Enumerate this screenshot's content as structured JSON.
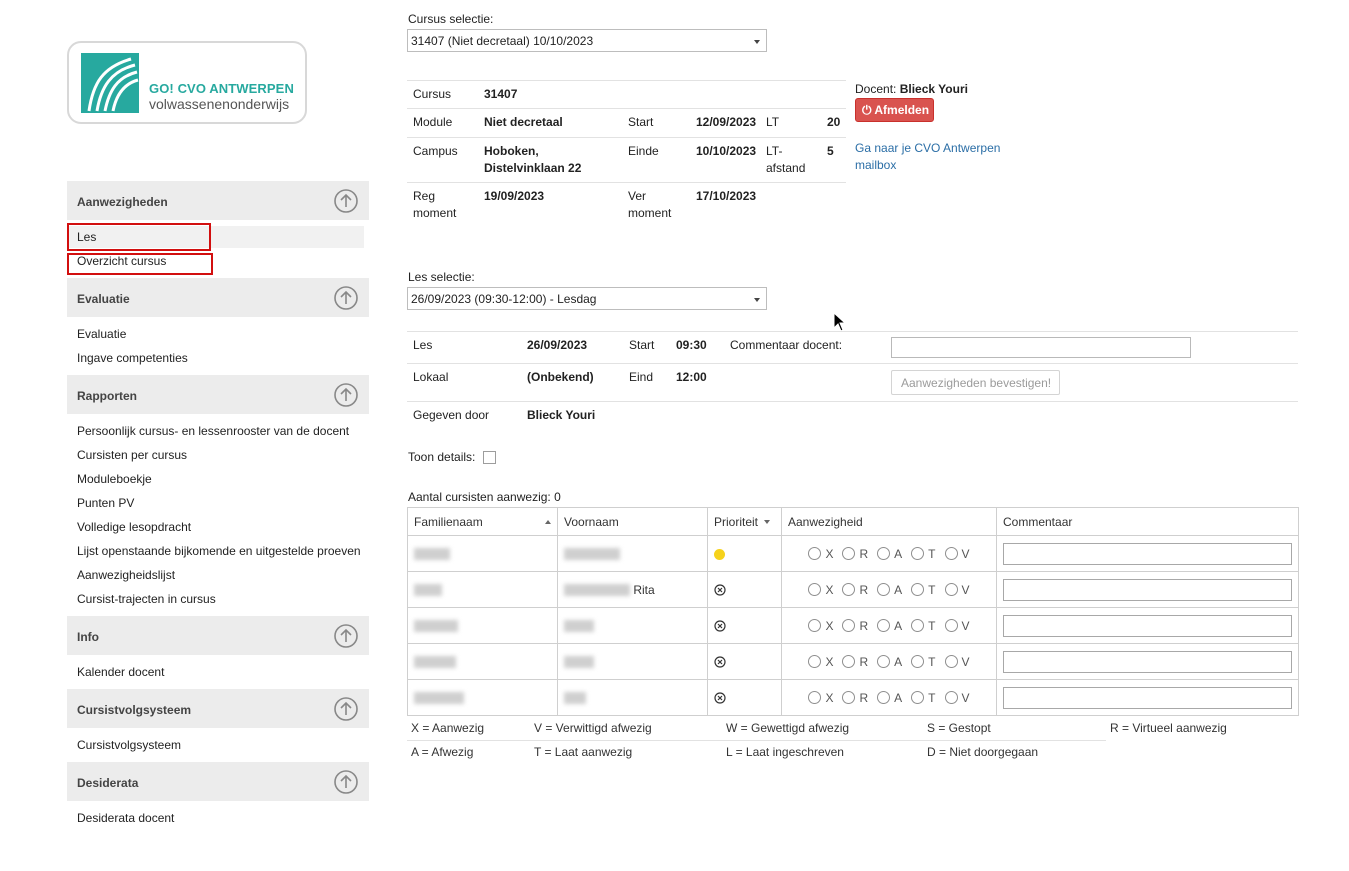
{
  "sidebar": {
    "logo": {
      "line1": "GO! CVO ANTWERPEN",
      "line2": "volwassenenonderwijs"
    },
    "sections": [
      {
        "title": "Aanwezigheden",
        "items": [
          "Les",
          "Overzicht cursus"
        ]
      },
      {
        "title": "Evaluatie",
        "items": [
          "Evaluatie",
          "Ingave competenties"
        ]
      },
      {
        "title": "Rapporten",
        "items": [
          "Persoonlijk cursus- en lessenrooster van de docent",
          "Cursisten per cursus",
          "Moduleboekje",
          "Punten PV",
          "Volledige lesopdracht",
          "Lijst openstaande bijkomende en uitgestelde proeven",
          "Aanwezigheidslijst",
          "Cursist-trajecten in cursus"
        ]
      },
      {
        "title": "Info",
        "items": [
          "Kalender docent"
        ]
      },
      {
        "title": "Cursistvolgsysteem",
        "items": [
          "Cursistvolgsysteem"
        ]
      },
      {
        "title": "Desiderata",
        "items": [
          "Desiderata docent"
        ]
      }
    ]
  },
  "course": {
    "selection_label": "Cursus selectie:",
    "selection_value": "31407 (Niet decretaal) 10/10/2023",
    "cursus_label": "Cursus",
    "cursus_value": "31407",
    "module_label": "Module",
    "module_value": "Niet decretaal",
    "start_label": "Start",
    "start_value": "12/09/2023",
    "lt_label": "LT",
    "lt_value": "20",
    "campus_label": "Campus",
    "campus_value_1": "Hoboken,",
    "campus_value_2": "Distelvinklaan 22",
    "einde_label": "Einde",
    "einde_value": "10/10/2023",
    "ltafstand_label_1": "LT-",
    "ltafstand_label_2": "afstand",
    "ltafstand_value": "5",
    "reg_label_1": "Reg",
    "reg_label_2": "moment",
    "reg_value": "19/09/2023",
    "ver_label_1": "Ver",
    "ver_label_2": "moment",
    "ver_value": "17/10/2023"
  },
  "docent": {
    "label": "Docent:",
    "name": "Blieck Youri",
    "logout": "Afmelden",
    "mailbox_line1": "Ga naar je CVO Antwerpen",
    "mailbox_line2": "mailbox"
  },
  "lesson": {
    "selection_label": "Les selectie:",
    "selection_value": "26/09/2023 (09:30-12:00) - Lesdag",
    "les_label": "Les",
    "les_value": "26/09/2023",
    "start_label": "Start",
    "start_value": "09:30",
    "comment_label": "Commentaar docent:",
    "lokaal_label": "Lokaal",
    "lokaal_value": "(Onbekend)",
    "eind_label": "Eind",
    "eind_value": "12:00",
    "confirm_button": "Aanwezigheden bevestigen!",
    "given_label": "Gegeven door",
    "given_value": "Blieck Youri",
    "details_label": "Toon details:",
    "count_label": "Aantal cursisten aanwezig: 0"
  },
  "table": {
    "headers": [
      "Familienaam",
      "Voornaam",
      "Prioriteit",
      "Aanwezigheid",
      "Commentaar"
    ],
    "radio_options": [
      "X",
      "R",
      "A",
      "T",
      "V"
    ],
    "rows": [
      {
        "voornaam_suffix": "",
        "priority": "yellow"
      },
      {
        "voornaam_suffix": "Rita",
        "priority": "x"
      },
      {
        "voornaam_suffix": "",
        "priority": "x"
      },
      {
        "voornaam_suffix": "",
        "priority": "x"
      },
      {
        "voornaam_suffix": "",
        "priority": "x"
      }
    ]
  },
  "legend": {
    "row1": [
      "X = Aanwezig",
      "V = Verwittigd afwezig",
      "W = Gewettigd afwezig",
      "S = Gestopt",
      "R = Virtueel aanwezig"
    ],
    "row2": [
      "A = Afwezig",
      "T = Laat aanwezig",
      "L = Laat ingeschreven",
      "D = Niet doorgegaan"
    ]
  },
  "colors": {
    "brand": "#27a99f",
    "danger": "#d9534f",
    "link": "#2b6ea6",
    "highlight": "#d20f0f"
  }
}
